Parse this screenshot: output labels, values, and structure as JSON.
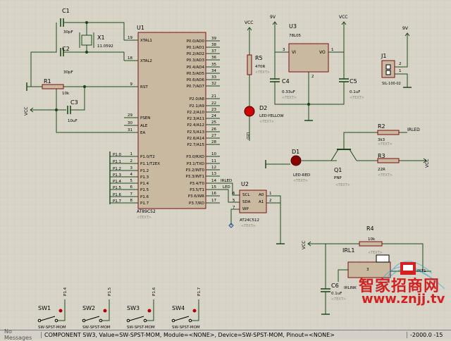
{
  "schematic": {
    "u1": {
      "ref": "U1",
      "part": "AT89C52",
      "text": "<TEXT>",
      "left_pins": [
        {
          "num": "19",
          "name": "XTAL1"
        },
        {
          "num": "18",
          "name": "XTAL2"
        },
        {
          "num": "9",
          "name": "RST"
        },
        {
          "num": "29",
          "name": "PSEN"
        },
        {
          "num": "30",
          "name": "ALE"
        },
        {
          "num": "31",
          "name": "EA"
        },
        {
          "num": "1",
          "name": "P1.0/T2"
        },
        {
          "num": "2",
          "name": "P1.1/T2EX"
        },
        {
          "num": "3",
          "name": "P1.2"
        },
        {
          "num": "4",
          "name": "P1.3"
        },
        {
          "num": "5",
          "name": "P1.4"
        },
        {
          "num": "6",
          "name": "P1.5"
        },
        {
          "num": "7",
          "name": "P1.6"
        },
        {
          "num": "8",
          "name": "P1.7"
        }
      ],
      "right_pins": [
        {
          "num": "39",
          "name": "P0.0/AD0"
        },
        {
          "num": "38",
          "name": "P0.1/AD1"
        },
        {
          "num": "37",
          "name": "P0.2/AD2"
        },
        {
          "num": "36",
          "name": "P0.3/AD3"
        },
        {
          "num": "35",
          "name": "P0.4/AD4"
        },
        {
          "num": "34",
          "name": "P0.5/AD5"
        },
        {
          "num": "33",
          "name": "P0.6/AD6"
        },
        {
          "num": "32",
          "name": "P0.7/AD7"
        },
        {
          "num": "21",
          "name": "P2.0/A8"
        },
        {
          "num": "22",
          "name": "P2.1/A9"
        },
        {
          "num": "23",
          "name": "P2.2/A10"
        },
        {
          "num": "24",
          "name": "P2.3/A11"
        },
        {
          "num": "25",
          "name": "P2.4/A12"
        },
        {
          "num": "26",
          "name": "P2.5/A13"
        },
        {
          "num": "27",
          "name": "P2.6/A14"
        },
        {
          "num": "28",
          "name": "P2.7/A15"
        },
        {
          "num": "10",
          "name": "P3.0/RXD"
        },
        {
          "num": "11",
          "name": "P3.1/TXD"
        },
        {
          "num": "12",
          "name": "P3.2/INT0"
        },
        {
          "num": "13",
          "name": "P3.3/INT1"
        },
        {
          "num": "14",
          "name": "P3.4/T0"
        },
        {
          "num": "15",
          "name": "P3.5/T1"
        },
        {
          "num": "16",
          "name": "P3.6/WR"
        },
        {
          "num": "17",
          "name": "P3.7/RD"
        }
      ],
      "port_labels": [
        "P1.0",
        "P1.1",
        "P1.2",
        "P1.3",
        "P1.4",
        "P1.5",
        "P1.6",
        "P1.7"
      ],
      "net_labels": {
        "irled": "IRLED",
        "led": "LED"
      }
    },
    "c1": {
      "ref": "C1",
      "value": "30pF"
    },
    "c2": {
      "ref": "C2",
      "value": "30pF"
    },
    "c3": {
      "ref": "C3",
      "value": "10uF"
    },
    "x1": {
      "ref": "X1",
      "value": "11.0592"
    },
    "r1": {
      "ref": "R1",
      "value": "10k"
    },
    "r5": {
      "ref": "R5",
      "value": "470R",
      "text": "<TEXT>"
    },
    "d2": {
      "ref": "D2",
      "value": "LED-YELLOW",
      "text": "<TEXT>",
      "side": "LED"
    },
    "u3": {
      "ref": "U3",
      "value": "78L05",
      "pin_vi": "VI",
      "pin_vo": "VO",
      "pin1": "1",
      "pin3": "3",
      "pin2": "2"
    },
    "c4": {
      "ref": "C4",
      "value": "0.33uF",
      "text": "<TEXT>"
    },
    "c5": {
      "ref": "C5",
      "value": "0.1uF",
      "text": "<TEXT>"
    },
    "j1": {
      "ref": "J1",
      "value": "SIL-100-02",
      "pin1": "1",
      "pin2": "2"
    },
    "d1": {
      "ref": "D1",
      "value": "LED-RED",
      "text": "<TEXT>"
    },
    "q1": {
      "ref": "Q1",
      "value": "PNP",
      "text": "<TEXT>"
    },
    "r2": {
      "ref": "R2",
      "value": "3k3",
      "text": "<TEXT>",
      "net": "IRLED"
    },
    "r3": {
      "ref": "R3",
      "value": "22R",
      "text": "<TEXT>"
    },
    "u2": {
      "ref": "U2",
      "value": "AT24C512",
      "text": "<TEXT>",
      "pins": [
        "SCL",
        "SDA",
        "WP",
        "A0",
        "A1"
      ],
      "pin_nums": [
        "6",
        "5",
        "7",
        "1",
        "2"
      ]
    },
    "r4": {
      "ref": "R4",
      "value": "10k",
      "text": "<TEXT>"
    },
    "irl1": {
      "ref": "IRL1",
      "value": "IRLINK",
      "pin": "INT1",
      "num": "3"
    },
    "c6": {
      "ref": "C6",
      "value": "0.1uF",
      "text": "<TEXT>"
    },
    "power": {
      "vcc": "VCC",
      "v9": "9V",
      "gnd": "GND"
    },
    "switches": [
      {
        "ref": "SW1",
        "value": "SW-SPST-MOM",
        "port": "P1.4"
      },
      {
        "ref": "SW2",
        "value": "SW-SPST-MOM",
        "port": "P1.5"
      },
      {
        "ref": "SW3",
        "value": "SW-SPST-MOM",
        "port": "P1.6"
      },
      {
        "ref": "SW4",
        "value": "SW-SPST-MOM",
        "port": "P1.7"
      }
    ]
  },
  "watermark": {
    "cn": "智家招商网",
    "url": "www.znjj.tv"
  },
  "status": {
    "message": "No Messages",
    "component": "COMPONENT SW3, Value=SW-SPST-MOM, Module=<NONE>, Device=SW-SPST-MOM, Pinout=<NONE>",
    "coord": "-2000.0  -15"
  },
  "colors": {
    "bg": "#d8d5c8",
    "wire": "#1a4a1a",
    "part": "#c9b9a0",
    "part_stroke": "#7a1010",
    "ref": "#000000",
    "pin_num": "#000000",
    "text_tag": "#8a8a7a",
    "led_red": "#8b0000",
    "led_yellow": "#cc0000",
    "wm_red": "#d42020",
    "wm_cyan": "#29a3d2"
  }
}
